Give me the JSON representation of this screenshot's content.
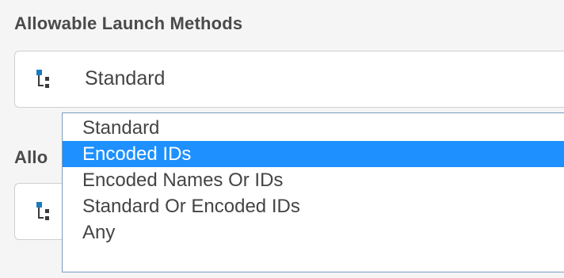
{
  "section1": {
    "label": "Allowable Launch Methods",
    "select": {
      "value": "Standard",
      "icon": "hierarchy-icon"
    }
  },
  "section2": {
    "label": "Allo",
    "select": {
      "value": "",
      "icon": "hierarchy-icon"
    }
  },
  "dropdown": {
    "options": [
      {
        "label": "Standard",
        "selected": false
      },
      {
        "label": "Encoded IDs",
        "selected": true
      },
      {
        "label": "Encoded Names Or IDs",
        "selected": false
      },
      {
        "label": "Standard Or Encoded IDs",
        "selected": false
      },
      {
        "label": "Any",
        "selected": false
      }
    ]
  },
  "colors": {
    "highlight": "#1e90ff",
    "icon_blue": "#1a7bbf",
    "icon_dark": "#3a3a3a",
    "text": "#444444"
  }
}
